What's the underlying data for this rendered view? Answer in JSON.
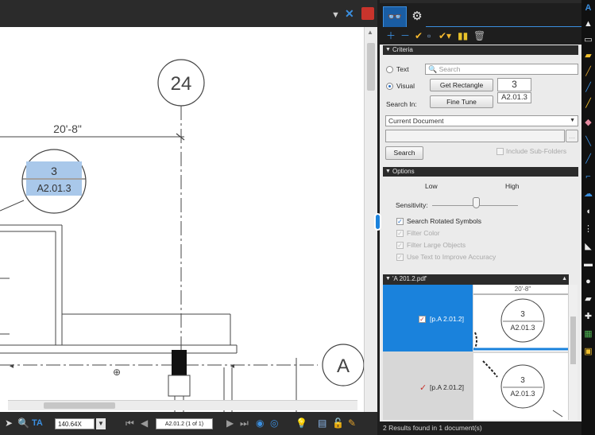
{
  "drawing": {
    "grid_bubble_number": "24",
    "grid_bubble_letter": "A",
    "dimension_text": "20'-8\"",
    "callout_top": "3",
    "callout_bottom": "A2.01.3"
  },
  "bottom_toolbar": {
    "zoom_value": "140.64X",
    "page_indicator": "A2.01.2 (1 of 1)"
  },
  "panel": {
    "criteria_header": "Criteria",
    "text_radio_label": "Text",
    "search_placeholder": "Search",
    "visual_radio_label": "Visual",
    "get_rectangle_button": "Get Rectangle",
    "fine_tune_button": "Fine Tune",
    "search_in_label": "Search In:",
    "symbol_top": "3",
    "symbol_bottom": "A2.01.3",
    "search_in_value": "Current Document",
    "search_button": "Search",
    "include_subfolders_label": "Include Sub-Folders",
    "options_header": "Options",
    "low_label": "Low",
    "high_label": "High",
    "sensitivity_label": "Sensitivity:",
    "search_rotated_label": "Search Rotated Symbols",
    "filter_color_label": "Filter Color",
    "filter_large_label": "Filter Large Objects",
    "use_text_label": "Use Text to Improve Accuracy",
    "results_header": "'A 201.2.pdf'",
    "results": [
      {
        "label": "[p.A 2.01.2]",
        "thumb_top": "3",
        "thumb_bottom": "A2.01.3",
        "thumb_dim": "20'-8\""
      },
      {
        "label": "[p.A 2.01.2]",
        "thumb_top": "3",
        "thumb_bottom": "A2.01.3",
        "thumb_dim": ""
      }
    ],
    "status_text": "2 Results found in 1 document(s)"
  },
  "colors": {
    "accent": "#1a82dc",
    "selected_row": "#1a82dc",
    "dark_chrome": "#1e1e1e",
    "highlight_fill": "#a9c8ea"
  },
  "icons": {
    "tabs": [
      "search-icon",
      "settings-gear-icon"
    ],
    "toolbar": [
      "add-icon",
      "remove-icon",
      "check-icon",
      "select-icon",
      "check-all-icon",
      "markup-icon",
      "delete-icon"
    ]
  }
}
